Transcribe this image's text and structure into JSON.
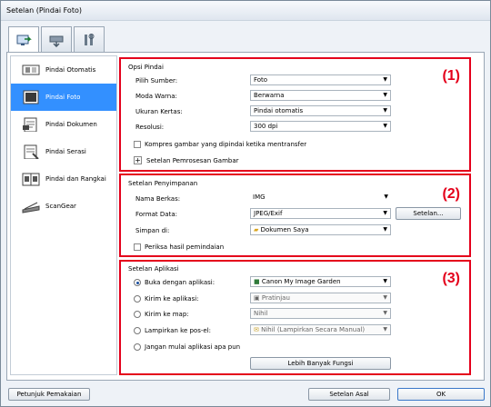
{
  "window": {
    "title": "Setelan (Pindai Foto)"
  },
  "sidebar": {
    "items": [
      {
        "label": "Pindai Otomatis",
        "icon": "auto-scan-icon"
      },
      {
        "label": "Pindai Foto",
        "icon": "photo-scan-icon"
      },
      {
        "label": "Pindai Dokumen",
        "icon": "document-scan-icon"
      },
      {
        "label": "Pindai Serasi",
        "icon": "custom-scan-icon"
      },
      {
        "label": "Pindai dan Rangkai",
        "icon": "scan-stitch-icon"
      },
      {
        "label": "ScanGear",
        "icon": "scangear-icon"
      }
    ]
  },
  "scan_options": {
    "title": "Opsi Pindai",
    "number": "(1)",
    "source_label": "Pilih Sumber:",
    "source_value": "Foto",
    "color_label": "Moda Warna:",
    "color_value": "Berwarna",
    "paper_label": "Ukuran Kertas:",
    "paper_value": "Pindai otomatis",
    "resolution_label": "Resolusi:",
    "resolution_value": "300 dpi",
    "compress_label": "Kompres gambar yang dipindai ketika mentransfer",
    "processing_label": "Setelan Pemrosesan Gambar"
  },
  "save_settings": {
    "title": "Setelan Penyimpanan",
    "number": "(2)",
    "filename_label": "Nama Berkas:",
    "filename_value": "IMG",
    "format_label": "Format Data:",
    "format_value": "JPEG/Exif",
    "settings_button": "Setelan...",
    "saveto_label": "Simpan di:",
    "saveto_value": "Dokumen Saya",
    "check_label": "Periksa hasil pemindaian"
  },
  "app_settings": {
    "title": "Setelan Aplikasi",
    "number": "(3)",
    "open_label": "Buka dengan aplikasi:",
    "open_value": "Canon My Image Garden",
    "send_label": "Kirim ke aplikasi:",
    "send_value": "Pratinjau",
    "folder_label": "Kirim ke map:",
    "folder_value": "Nihil",
    "email_label": "Lampirkan ke pos-el:",
    "email_value": "Nihil (Lampirkan Secara Manual)",
    "none_label": "Jangan mulai aplikasi apa pun",
    "more_button": "Lebih Banyak Fungsi"
  },
  "footer": {
    "manual_button": "Petunjuk Pemakaian",
    "defaults_button": "Setelan Asal",
    "ok_button": "OK"
  }
}
